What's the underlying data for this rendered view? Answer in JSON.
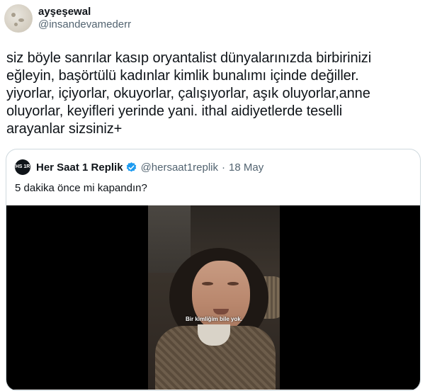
{
  "author": {
    "display_name": "ayşeşewal",
    "handle": "@insandevamederr"
  },
  "tweet": {
    "text": "siz böyle sanrılar kasıp oryantalist dünyalarınızda birbirinizi\neğleyin, başörtülü kadınlar kimlik bunalımı içinde değiller.\nyiyorlar, içiyorlar, okuyorlar, çalışıyorlar, aşık oluyorlar,anne\noluyorlar, keyifleri yerinde yani. ithal aidiyetlerde teselli\narayanlar sizsiniz+"
  },
  "quote": {
    "avatar_text": "HS 1R",
    "display_name": "Her Saat 1 Replik",
    "verified_icon": "verified-badge-icon",
    "handle": "@hersaat1replik",
    "separator": "·",
    "date": "18 May",
    "text": "5 dakika önce mi kapandın?",
    "video_subtitle": "Bir kimliğim bile yok."
  },
  "colors": {
    "text": "#0f1419",
    "secondary": "#536471",
    "border": "#cfd9de",
    "verified": "#1d9bf0"
  }
}
